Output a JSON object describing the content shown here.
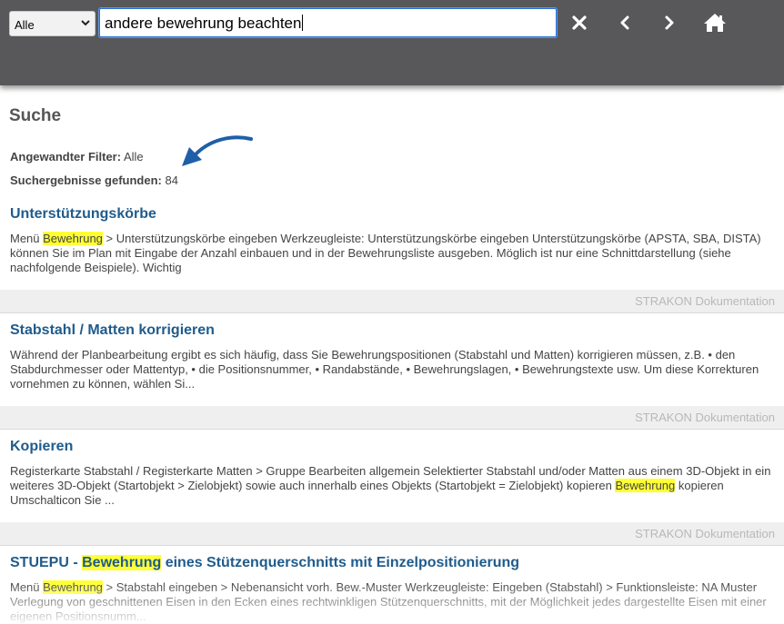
{
  "toolbar": {
    "filter_value": "Alle",
    "search_value": "andere bewehrung beachten",
    "close_icon": "close-icon",
    "back_icon": "chevron-left-icon",
    "forward_icon": "chevron-right-icon",
    "home_icon": "home-icon"
  },
  "page": {
    "title": "Suche",
    "filter_label": "Angewandter Filter:",
    "filter_value": "Alle",
    "count_label": "Suchergebnisse gefunden:",
    "count_value": "84"
  },
  "results": [
    {
      "title_pre": "Unterstützungskörbe",
      "title_hl": "",
      "title_post": "",
      "snippet": [
        {
          "t": "Menü "
        },
        {
          "t": "Bewehrung",
          "hl": true
        },
        {
          "t": " > Unterstützungskörbe eingeben Werkzeugleiste: Unterstützungskörbe eingeben Unterstützungskörbe (APSTA, SBA, DISTA) können Sie im Plan mit Eingabe der Anzahl einbauen und in der Bewehrungsliste ausgeben. Möglich ist nur eine Schnittdarstellung (siehe nachfolgende Beispiele). Wichtig"
        }
      ],
      "source": "STRAKON Dokumentation"
    },
    {
      "title_pre": "Stabstahl / Matten korrigieren",
      "title_hl": "",
      "title_post": "",
      "snippet": [
        {
          "t": "Während der Planbearbeitung ergibt es sich häufig, dass Sie Bewehrungspositionen (Stabstahl und Matten) korrigieren müssen, z.B. • den Stabdurchmesser oder Mattentyp, • die Positionsnummer, • Randabstände, • Bewehrungslagen, • Bewehrungstexte usw. Um diese Korrekturen vornehmen zu können, wählen Si..."
        }
      ],
      "source": "STRAKON Dokumentation"
    },
    {
      "title_pre": "Kopieren",
      "title_hl": "",
      "title_post": "",
      "snippet": [
        {
          "t": "Registerkarte Stabstahl / Registerkarte Matten > Gruppe Bearbeiten allgemein Selektierter Stabstahl und/oder Matten aus einem 3D-Objekt in ein weiteres 3D-Objekt (Startobjekt > Zielobjekt) sowie auch innerhalb eines Objekts (Startobjekt = Zielobjekt) kopieren "
        },
        {
          "t": "Bewehrung",
          "hl": true
        },
        {
          "t": " kopieren Umschalticon Sie ..."
        }
      ],
      "source": "STRAKON Dokumentation"
    },
    {
      "title_pre": "STUEPU - ",
      "title_hl": "Bewehrung",
      "title_post": " eines Stützenquerschnitts mit Einzelpositionierung",
      "snippet": [
        {
          "t": "Menü "
        },
        {
          "t": "Bewehrung",
          "hl": true
        },
        {
          "t": " > Stabstahl eingeben > Nebenansicht vorh. Bew.-Muster Werkzeugleiste: Eingeben (Stabstahl) > Funktionsleiste: NA Muster Verlegung von geschnittenen Eisen in den Ecken eines rechtwinkligen Stützenquerschnitts, mit der Möglichkeit jedes dargestellte Eisen mit einer eigenen Positionsnumm..."
        }
      ],
      "source": ""
    }
  ]
}
